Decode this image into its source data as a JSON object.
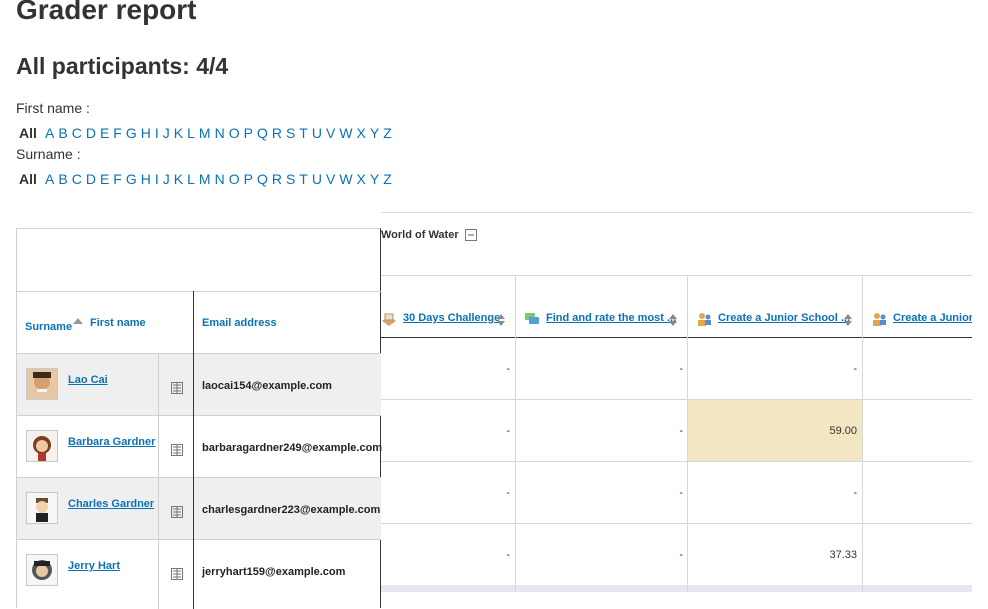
{
  "page_title": "Grader report",
  "participants_heading": "All participants: 4/4",
  "filters": {
    "first_name_label": "First name :",
    "surname_label": "Surname :",
    "all_label": "All",
    "letters": [
      "A",
      "B",
      "C",
      "D",
      "E",
      "F",
      "G",
      "H",
      "I",
      "J",
      "K",
      "L",
      "M",
      "N",
      "O",
      "P",
      "Q",
      "R",
      "S",
      "T",
      "U",
      "V",
      "W",
      "X",
      "Y",
      "Z"
    ]
  },
  "table": {
    "category_title": "World of Water",
    "headers": {
      "surname": "Surname",
      "first_name": "First name",
      "email": "Email address"
    },
    "grade_columns": [
      {
        "label": "30 Days Challenge",
        "icon": "assignment-icon"
      },
      {
        "label": "Find and rate the most ...",
        "icon": "forum-icon"
      },
      {
        "label": "Create a Junior School ...",
        "icon": "workshop-icon"
      },
      {
        "label": "Create a Junior S",
        "icon": "workshop-icon"
      }
    ],
    "rows": [
      {
        "name": "Lao Cai",
        "email": "laocai154@example.com",
        "grades": [
          "-",
          "-",
          "-"
        ]
      },
      {
        "name": "Barbara Gardner",
        "email": "barbaragardner249@example.com",
        "grades": [
          "-",
          "-",
          "59.00"
        ]
      },
      {
        "name": "Charles Gardner",
        "email": "charlesgardner223@example.com",
        "grades": [
          "-",
          "-",
          "-"
        ]
      },
      {
        "name": "Jerry Hart",
        "email": "jerryhart159@example.com",
        "grades": [
          "-",
          "-",
          "37.33"
        ]
      }
    ]
  },
  "colors": {
    "link": "#0a72b5",
    "highlight": "#f3e6c2",
    "alt_row": "#efefef"
  }
}
